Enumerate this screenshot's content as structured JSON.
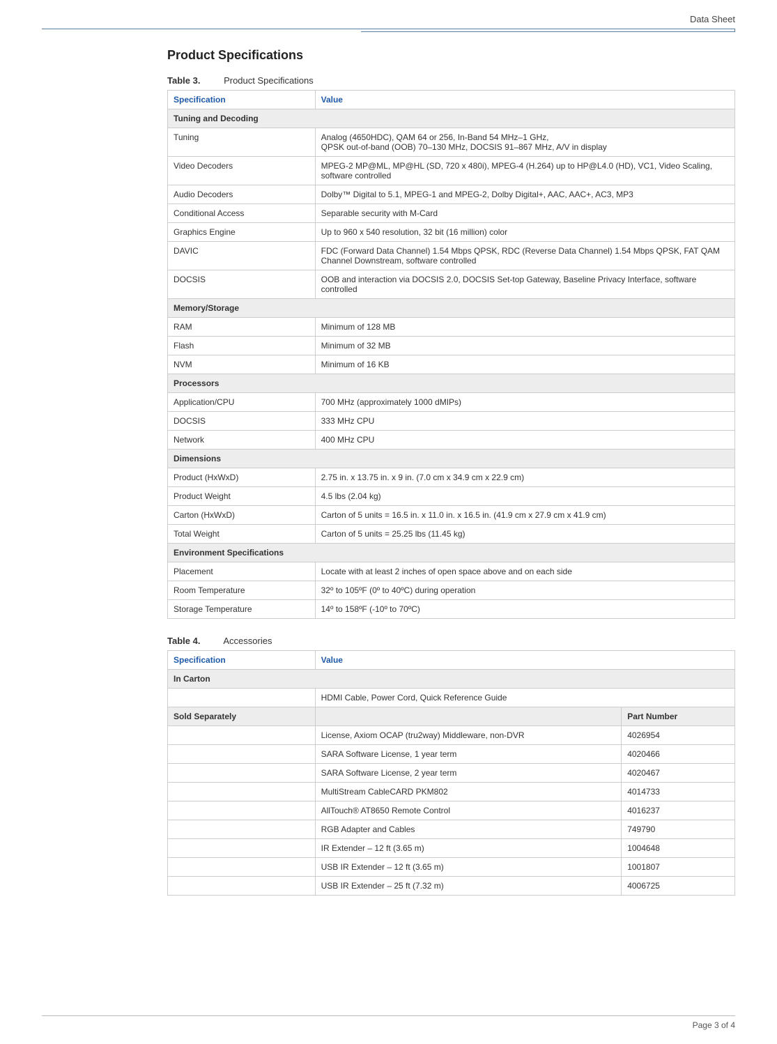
{
  "header": {
    "label": "Data Sheet"
  },
  "section_title": "Product Specifications",
  "table3": {
    "caption_label": "Table 3.",
    "caption_text": "Product Specifications",
    "head_spec": "Specification",
    "head_value": "Value",
    "groups": [
      {
        "title": "Tuning and Decoding",
        "rows": [
          {
            "spec": "Tuning",
            "value": "Analog (4650HDC), QAM 64 or 256, In-Band 54 MHz–1 GHz,\nQPSK out-of-band (OOB) 70–130 MHz, DOCSIS 91–867 MHz, A/V in display"
          },
          {
            "spec": "Video Decoders",
            "value": "MPEG-2 MP@ML, MP@HL (SD, 720 x 480i), MPEG-4 (H.264) up to HP@L4.0 (HD), VC1, Video Scaling, software controlled"
          },
          {
            "spec": "Audio Decoders",
            "value": "Dolby™ Digital to 5.1, MPEG-1 and MPEG-2, Dolby Digital+, AAC, AAC+, AC3, MP3"
          },
          {
            "spec": "Conditional Access",
            "value": "Separable security with M-Card"
          },
          {
            "spec": "Graphics Engine",
            "value": "Up to 960 x 540 resolution, 32 bit (16 million) color"
          },
          {
            "spec": "DAVIC",
            "value": "FDC (Forward Data Channel) 1.54 Mbps QPSK, RDC (Reverse Data Channel) 1.54 Mbps QPSK, FAT QAM Channel Downstream, software controlled"
          },
          {
            "spec": "DOCSIS",
            "value": "OOB and interaction via DOCSIS 2.0, DOCSIS Set-top Gateway, Baseline Privacy Interface, software controlled"
          }
        ]
      },
      {
        "title": "Memory/Storage",
        "rows": [
          {
            "spec": "RAM",
            "value": "Minimum of 128 MB"
          },
          {
            "spec": "Flash",
            "value": "Minimum of 32 MB"
          },
          {
            "spec": "NVM",
            "value": "Minimum of 16 KB"
          }
        ]
      },
      {
        "title": "Processors",
        "rows": [
          {
            "spec": "Application/CPU",
            "value": "700 MHz (approximately 1000 dMIPs)"
          },
          {
            "spec": "DOCSIS",
            "value": "333 MHz CPU"
          },
          {
            "spec": "Network",
            "value": "400 MHz CPU"
          }
        ]
      },
      {
        "title": "Dimensions",
        "rows": [
          {
            "spec": "Product (HxWxD)",
            "value": "2.75 in. x 13.75 in. x 9 in. (7.0 cm x 34.9 cm x 22.9 cm)"
          },
          {
            "spec": "Product Weight",
            "value": "4.5 lbs (2.04 kg)"
          },
          {
            "spec": "Carton (HxWxD)",
            "value": "Carton of 5 units = 16.5 in. x 11.0 in. x 16.5 in. (41.9 cm x 27.9 cm x 41.9 cm)"
          },
          {
            "spec": "Total Weight",
            "value": "Carton of 5 units = 25.25 lbs (11.45 kg)"
          }
        ]
      },
      {
        "title": "Environment Specifications",
        "rows": [
          {
            "spec": "Placement",
            "value": "Locate with at least 2 inches of open space above and on each side"
          },
          {
            "spec": "Room Temperature",
            "value": "32º to 105ºF (0º to 40ºC) during operation"
          },
          {
            "spec": "Storage Temperature",
            "value": "14º to 158ºF (-10º to 70ºC)"
          }
        ]
      }
    ]
  },
  "table4": {
    "caption_label": "Table 4.",
    "caption_text": "Accessories",
    "head_spec": "Specification",
    "head_value": "Value",
    "in_carton_title": "In Carton",
    "in_carton_value": "HDMI Cable, Power Cord, Quick Reference Guide",
    "sold_separately_title": "Sold Separately",
    "part_number_title": "Part Number",
    "items": [
      {
        "desc": "License, Axiom OCAP (tru2way) Middleware, non-DVR",
        "pn": "4026954"
      },
      {
        "desc": "SARA Software License, 1 year term",
        "pn": "4020466"
      },
      {
        "desc": "SARA Software License, 2 year term",
        "pn": "4020467"
      },
      {
        "desc": "MultiStream CableCARD PKM802",
        "pn": "4014733"
      },
      {
        "desc": "AllTouch® AT8650 Remote Control",
        "pn": "4016237"
      },
      {
        "desc": "RGB Adapter and Cables",
        "pn": "749790"
      },
      {
        "desc": "IR Extender – 12 ft (3.65 m)",
        "pn": "1004648"
      },
      {
        "desc": "USB IR Extender – 12 ft (3.65 m)",
        "pn": "1001807"
      },
      {
        "desc": "USB IR Extender – 25 ft (7.32 m)",
        "pn": "4006725"
      }
    ]
  },
  "footer": {
    "text": "Page 3 of 4"
  }
}
